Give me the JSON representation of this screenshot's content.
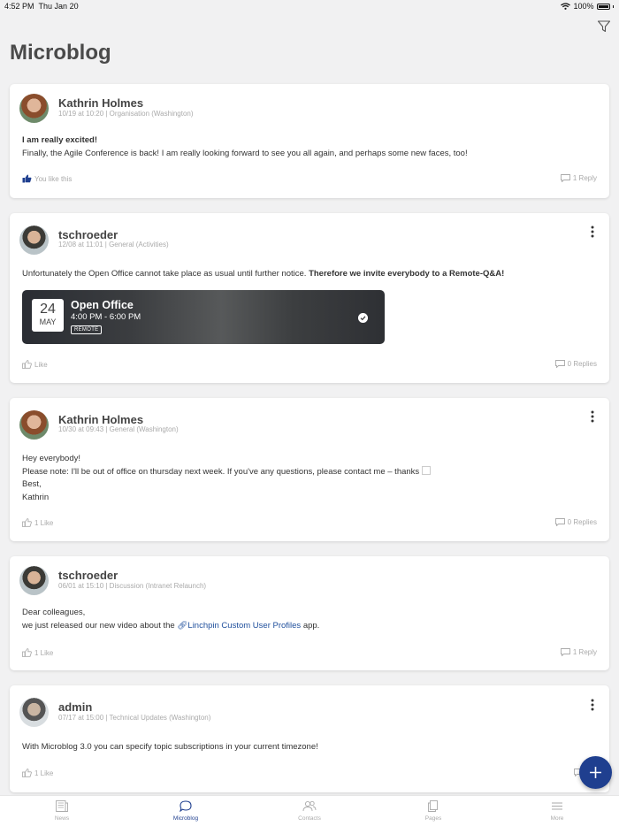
{
  "status": {
    "time": "4:52 PM",
    "date": "Thu Jan 20",
    "battery": "100%"
  },
  "page": {
    "title": "Microblog"
  },
  "posts": [
    {
      "author": "Kathrin Holmes",
      "meta": "10/19 at 10:20 | Organisation (Washington)",
      "headline": "I am really excited!",
      "text": "Finally, the Agile Conference is back! I am really looking forward to see you all again, and perhaps some new faces, too!",
      "like_label": "You like this",
      "reply_label": "1 Reply"
    },
    {
      "author": "tschroeder",
      "meta": "12/08 at 11:01 | General (Activities)",
      "text_plain": "Unfortunately the Open Office cannot take place as usual until further notice. ",
      "text_bold": "Therefore we invite everybody to a Remote-Q&A!",
      "event": {
        "day": "24",
        "month": "MAY",
        "title": "Open Office",
        "time": "4:00 PM - 6:00 PM",
        "tag": "REMOTE"
      },
      "like_label": "Like",
      "reply_label": "0 Replies"
    },
    {
      "author": "Kathrin Holmes",
      "meta": "10/30 at 09:43 | General (Washington)",
      "lines": [
        "Hey everybody!",
        "Please note: I'll be out of office on thursday next week. If you've any questions, please contact me – thanks",
        "Best,",
        "Kathrin"
      ],
      "like_label": "1 Like",
      "reply_label": "0 Replies"
    },
    {
      "author": "tschroeder",
      "meta": "06/01 at 15:10 | Discussion (Intranet Relaunch)",
      "line1": "Dear colleagues,",
      "line2_pre": "we just released our new video about the ",
      "link_text": "Linchpin Custom User Profiles",
      "line2_post": " app.",
      "like_label": "1 Like",
      "reply_label": "1 Reply"
    },
    {
      "author": "admin",
      "meta": "07/17 at 15:00 | Technical Updates (Washington)",
      "text": "With Microblog 3.0 you can specify topic subscriptions in your current timezone!",
      "like_label": "1 Like",
      "reply_label": "0 R"
    }
  ],
  "tabs": [
    {
      "label": "News",
      "icon": "news-icon"
    },
    {
      "label": "Microblog",
      "icon": "microblog-icon",
      "active": true
    },
    {
      "label": "Contacts",
      "icon": "contacts-icon"
    },
    {
      "label": "Pages",
      "icon": "pages-icon"
    },
    {
      "label": "More",
      "icon": "more-icon"
    }
  ],
  "colors": {
    "accent": "#1f3f8f",
    "link": "#1f4f9c",
    "background": "#f1f1f2"
  }
}
